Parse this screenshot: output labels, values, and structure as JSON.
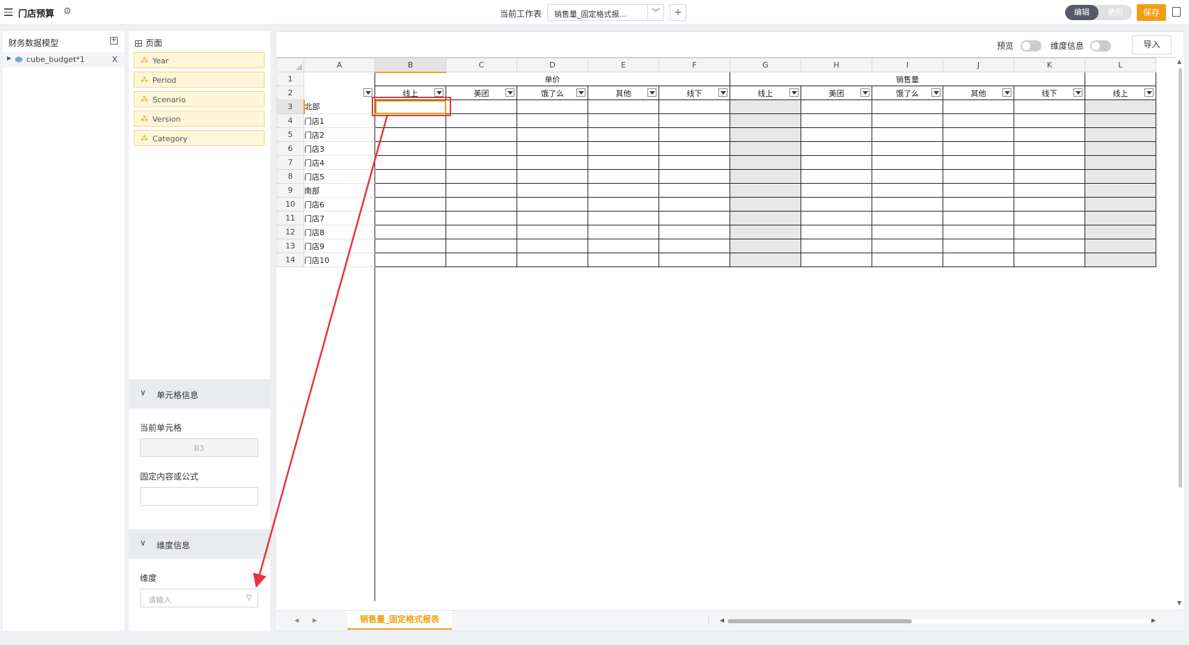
{
  "topbar": {
    "title": "门店预算",
    "current_sheet_label": "当前工作表",
    "current_sheet_value": "销售量_固定格式报...",
    "mode_edit": "编辑",
    "mode_use": "使用",
    "save_label": "保存"
  },
  "model_panel": {
    "title": "财务数据模型",
    "cube_name": "cube_budget*1",
    "close_label": "X"
  },
  "dims_panel": {
    "page_label": "页面",
    "dims": [
      "Year",
      "Period",
      "Scenario",
      "Version",
      "Category"
    ]
  },
  "cell_info": {
    "title": "单元格信息",
    "current_cell_label": "当前单元格",
    "current_cell_value": "B3",
    "formula_label": "固定内容或公式",
    "formula_value": ""
  },
  "dim_info": {
    "title": "维度信息",
    "dimension_label": "维度",
    "dimension_placeholder": "请输入"
  },
  "sheet_toolbar": {
    "preview_label": "预览",
    "preview_on": false,
    "dim_info_label": "维度信息",
    "dim_info_on": false,
    "import_label": "导入"
  },
  "grid": {
    "columns": [
      "A",
      "B",
      "C",
      "D",
      "E",
      "F",
      "G",
      "H",
      "I",
      "J",
      "K",
      "L"
    ],
    "selected_column": "B",
    "selected_row": 3,
    "group_headers": [
      "单价",
      "销售量"
    ],
    "sub_headers": [
      "线上",
      "美团",
      "饿了么",
      "其他",
      "线下",
      "线上",
      "美团",
      "饿了么",
      "其他",
      "线下",
      "线上"
    ],
    "row_numbers": [
      1,
      2,
      3,
      4,
      5,
      6,
      7,
      8,
      9,
      10,
      11,
      12,
      13,
      14
    ],
    "row_labels": [
      "北部",
      "门店1",
      "门店2",
      "门店3",
      "门店4",
      "门店5",
      "南部",
      "门店6",
      "门店7",
      "门店8",
      "门店9",
      "门店10"
    ],
    "gray_columns": [
      "G",
      "L"
    ]
  },
  "tabs": {
    "active": "销售量_固定格式报表"
  },
  "colors": {
    "accent": "#f39c12",
    "highlight_red": "#e8333a"
  }
}
